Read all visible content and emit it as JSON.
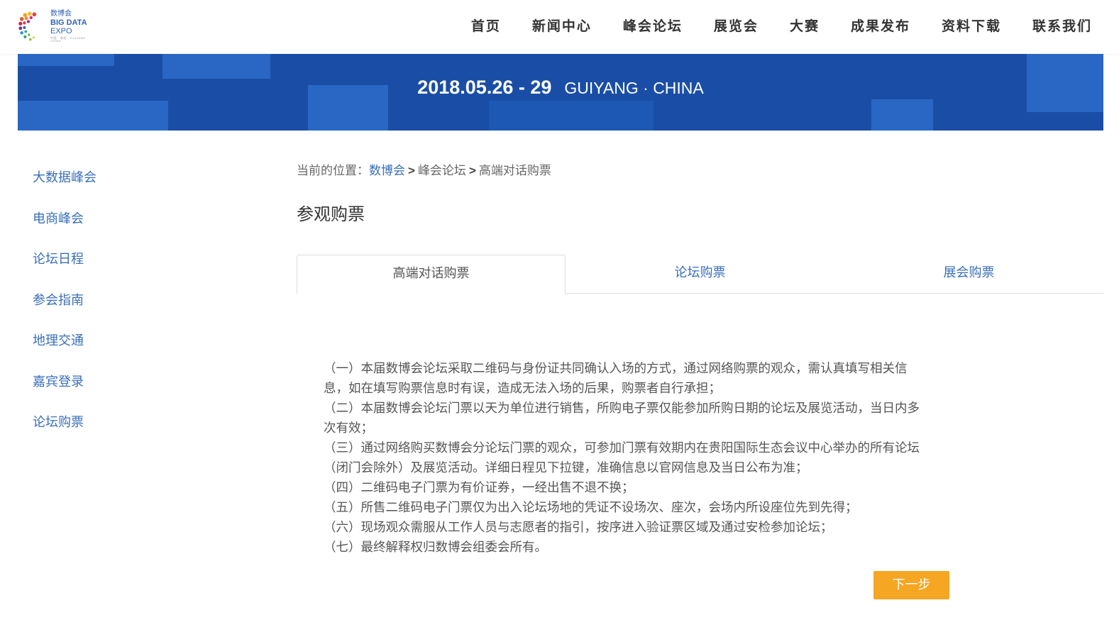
{
  "logo": {
    "cn": "数博会",
    "en_line1": "BIG DATA",
    "en_line2": "EXPO",
    "sub": "中国 · 贵阳 · GUIYANG · CHINA"
  },
  "nav": {
    "items": [
      "首页",
      "新闻中心",
      "峰会论坛",
      "展览会",
      "大赛",
      "成果发布",
      "资料下载",
      "联系我们"
    ]
  },
  "banner": {
    "date": "2018.05.26 - 29",
    "location": "GUIYANG · CHINA"
  },
  "sidebar": {
    "items": [
      "大数据峰会",
      "电商峰会",
      "论坛日程",
      "参会指南",
      "地理交通",
      "嘉宾登录",
      "论坛购票"
    ]
  },
  "breadcrumb": {
    "prefix": "当前的位置：",
    "crumb1": "数博会",
    "sep": ">",
    "crumb2": "峰会论坛",
    "crumb3": "高端对话购票"
  },
  "page_title": "参观购票",
  "tabs": [
    "高端对话购票",
    "论坛购票",
    "展会购票"
  ],
  "rules": [
    "（一）本届数博会论坛采取二维码与身份证共同确认入场的方式，通过网络购票的观众，需认真填写相关信息，如在填写购票信息时有误，造成无法入场的后果，购票者自行承担；",
    "（二）本届数博会论坛门票以天为单位进行销售，所购电子票仅能参加所购日期的论坛及展览活动，当日内多次有效；",
    "（三）通过网络购买数博会分论坛门票的观众，可参加门票有效期内在贵阳国际生态会议中心举办的所有论坛（闭门会除外）及展览活动。详细日程见下拉键，准确信息以官网信息及当日公布为准；",
    "（四）二维码电子门票为有价证券，一经出售不退不换；",
    "（五）所售二维码电子门票仅为出入论坛场地的凭证不设场次、座次，会场内所设座位先到先得；",
    "（六）现场观众需服从工作人员与志愿者的指引，按序进入验证票区域及通过安检参加论坛；",
    "（七）最终解释权归数博会组委会所有。"
  ],
  "next_button": "下一步",
  "colors": {
    "banner_bg": "#1a4ea6",
    "link_blue": "#3a6fb8",
    "button_orange": "#f5a623"
  }
}
